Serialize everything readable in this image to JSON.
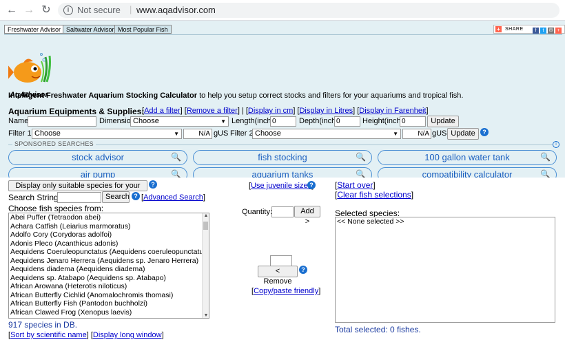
{
  "browser": {
    "security": "Not secure",
    "url": "www.aqadvisor.com"
  },
  "tabs": [
    "Freshwater Advisor",
    "Saltwater Advisor",
    "Most Popular Fish"
  ],
  "share": {
    "label": "SHARE"
  },
  "logo": {
    "text": "AqAdvisor"
  },
  "intro": {
    "bold": "Intelligent Freshwater Aquarium Stocking Calculator",
    "rest": " to help you setup correct stocks and filters for your aquariums and tropical fish."
  },
  "equipment": {
    "title": "Aquarium Equipments & Supplies:",
    "add_filter": "Add a filter",
    "remove_filter": "Remove a filter",
    "display_cm": "Display in cm",
    "display_litres": "Display in Litres",
    "display_farenheit": "Display in Farenheit",
    "name_label": "Name",
    "name_value": "",
    "dimension_label": "Dimension",
    "dimension_value": "Choose",
    "length_label": "Length(inch)",
    "length_value": "0",
    "depth_label": "Depth(inch)",
    "depth_value": "0",
    "height_label": "Height(inch)",
    "height_value": "0",
    "update_label": "Update",
    "filter1_label": "Filter 1",
    "filter1_value": "Choose",
    "filter1_na": "N/A",
    "gus_label": "gUS",
    "filter2_label": "Filter 2",
    "filter2_value": "Choose",
    "filter2_na": "N/A"
  },
  "sponsored": {
    "label": "SPONSORED SEARCHES",
    "items": [
      "stock advisor",
      "fish stocking",
      "100 gallon water tank",
      "air pump",
      "aquarium tanks",
      "compatibility calculator"
    ]
  },
  "species": {
    "display_suitable": "Display only suitable species for your tank",
    "search_label": "Search String",
    "search_value": "",
    "search_button": "Search",
    "advanced_search": "Advanced Search",
    "choose_label": "Choose fish species from:",
    "list": [
      "Abei Puffer (Tetraodon abei)",
      "Achara Catfish (Leiarius marmoratus)",
      "Adolfo Cory (Corydoras adolfoi)",
      "Adonis Pleco (Acanthicus adonis)",
      "Aequidens Coeruleopunctatus (Aequidens coeruleopunctatus)",
      "Aequidens Jenaro Herrera (Aequidens sp. Jenaro Herrera)",
      "Aequidens diadema (Aequidens diadema)",
      "Aequidens sp. Atabapo (Aequidens sp. Atabapo)",
      "African Arowana (Heterotis niloticus)",
      "African Butterfly Cichlid (Anomalochromis thomasi)",
      "African Butterfly Fish (Pantodon buchholzi)",
      "African Clawed Frog (Xenopus laevis)"
    ],
    "count": "917 species in DB.",
    "sort_link": "Sort by scientific name",
    "long_window": "Display long window",
    "juvenile": "Use juvenile sizes",
    "quantity_label": "Quantity:",
    "quantity_value": "",
    "add_button": "Add >",
    "remove_button": "< Remove",
    "remove_value": "",
    "copy_paste": "Copy/paste friendly",
    "start_over": "Start over",
    "clear_selections": "Clear fish selections",
    "selected_label": "Selected species:",
    "selected_placeholder": "<< None selected >>",
    "total": "Total selected: 0 fishes."
  }
}
